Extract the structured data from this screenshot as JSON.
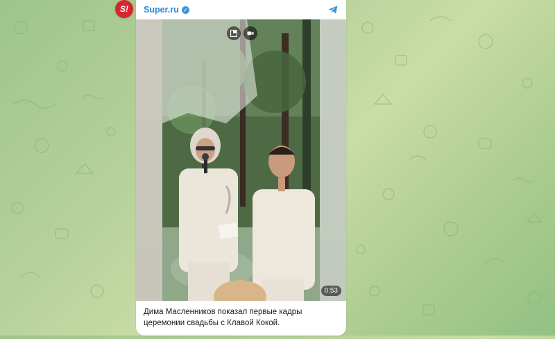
{
  "channel": {
    "name": "Super.ru",
    "avatar_text": "S!",
    "avatar_color": "#d8262f",
    "verified": true,
    "accent": "#2b8ad8"
  },
  "media": {
    "type": "video",
    "duration": "0:53",
    "controls": [
      "picture-in-picture-icon",
      "video-camera-icon"
    ]
  },
  "post": {
    "caption": "Дима Масленников показал первые кадры церемонии свадьбы с Клавой Кокой."
  },
  "icons": {
    "share": "telegram-share-icon",
    "verified": "verified-badge-icon"
  },
  "colors": {
    "wallpaper": "#a9cb8e",
    "card": "#ffffff"
  }
}
